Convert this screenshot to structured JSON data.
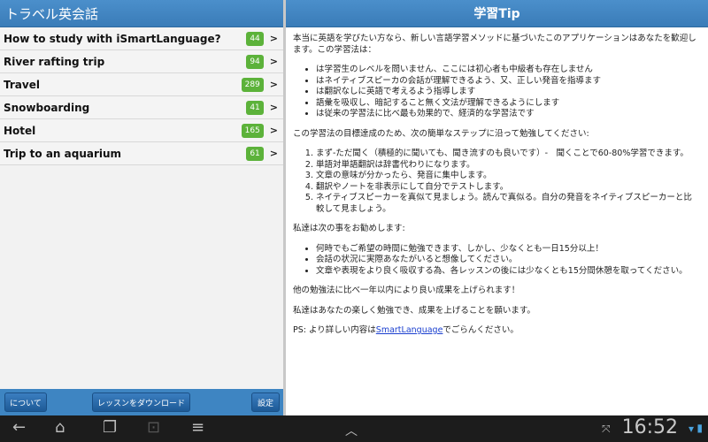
{
  "left": {
    "title": "トラベル英会話",
    "items": [
      {
        "label": "How to study with iSmartLanguage?",
        "count": "44"
      },
      {
        "label": "River rafting trip",
        "count": "94"
      },
      {
        "label": "Travel",
        "count": "289"
      },
      {
        "label": "Snowboarding",
        "count": "41"
      },
      {
        "label": "Hotel",
        "count": "165"
      },
      {
        "label": "Trip to an aquarium",
        "count": "61"
      }
    ],
    "chevron": ">",
    "buttons": {
      "about": "について",
      "download": "レッスンをダウンロード",
      "settings": "設定"
    }
  },
  "right": {
    "title": "学習Tip",
    "intro": "本当に英語を学びたい方なら、新しい言語学習メソッドに基づいたこのアプリケーションはあなたを歓迎します。この学習法は：",
    "features": [
      "は学習生のレベルを問いません、ここには初心者も中級者も存在しません",
      "はネイティブスピーカの会話が理解できるよう、又、正しい発音を指導ます",
      "は翻訳なしに英語で考えるよう指導します",
      "語彙を吸収し、暗記すること無く文法が理解できるようにします",
      "は従来の学習法に比べ最も効果的で、経済的な学習法です"
    ],
    "steps_intro": "この学習法の目標達成のため、次の簡単なステップに沿って勉強してください:",
    "steps": [
      "まず-ただ聞く（積極的に聞いても、聞き流すのも良いです）-　聞くことで60-80%学習できます。",
      "単語対単語翻訳は辞書代わりになります。",
      "文章の意味が分かったら、発音に集中します。",
      "翻訳やノートを非表示にして自分でテストします。",
      "ネイティブスピーカーを真似て見ましょう。読んで真似る。自分の発音をネイティブスピーカーと比較して見ましょう。"
    ],
    "recommend_intro": "私達は次の事をお勧めします:",
    "recommendations": [
      "何時でもご希望の時間に勉強できます、しかし、少なくとも一日15分以上！",
      "会話の状況に実際あなたがいると想像してください。",
      "文章や表現をより良く吸収する為、各レッスンの後には少なくとも15分間休憩を取ってください。"
    ],
    "result": "他の勉強法に比べ一年以内により良い成果を上げられます！",
    "wish": "私達はあなたの楽しく勉強でき、成果を上げることを願います。",
    "ps_prefix": "PS: より詳しい内容は",
    "ps_link": "SmartLanguage",
    "ps_suffix": "でごらんください。"
  },
  "navbar": {
    "time": "16:52",
    "icons": [
      "back-icon",
      "home-icon",
      "recent-apps-icon",
      "screenshot-icon",
      "menu-icon",
      "up-chevron-icon",
      "fullscreen-icon",
      "wifi-icon",
      "battery-icon"
    ]
  }
}
